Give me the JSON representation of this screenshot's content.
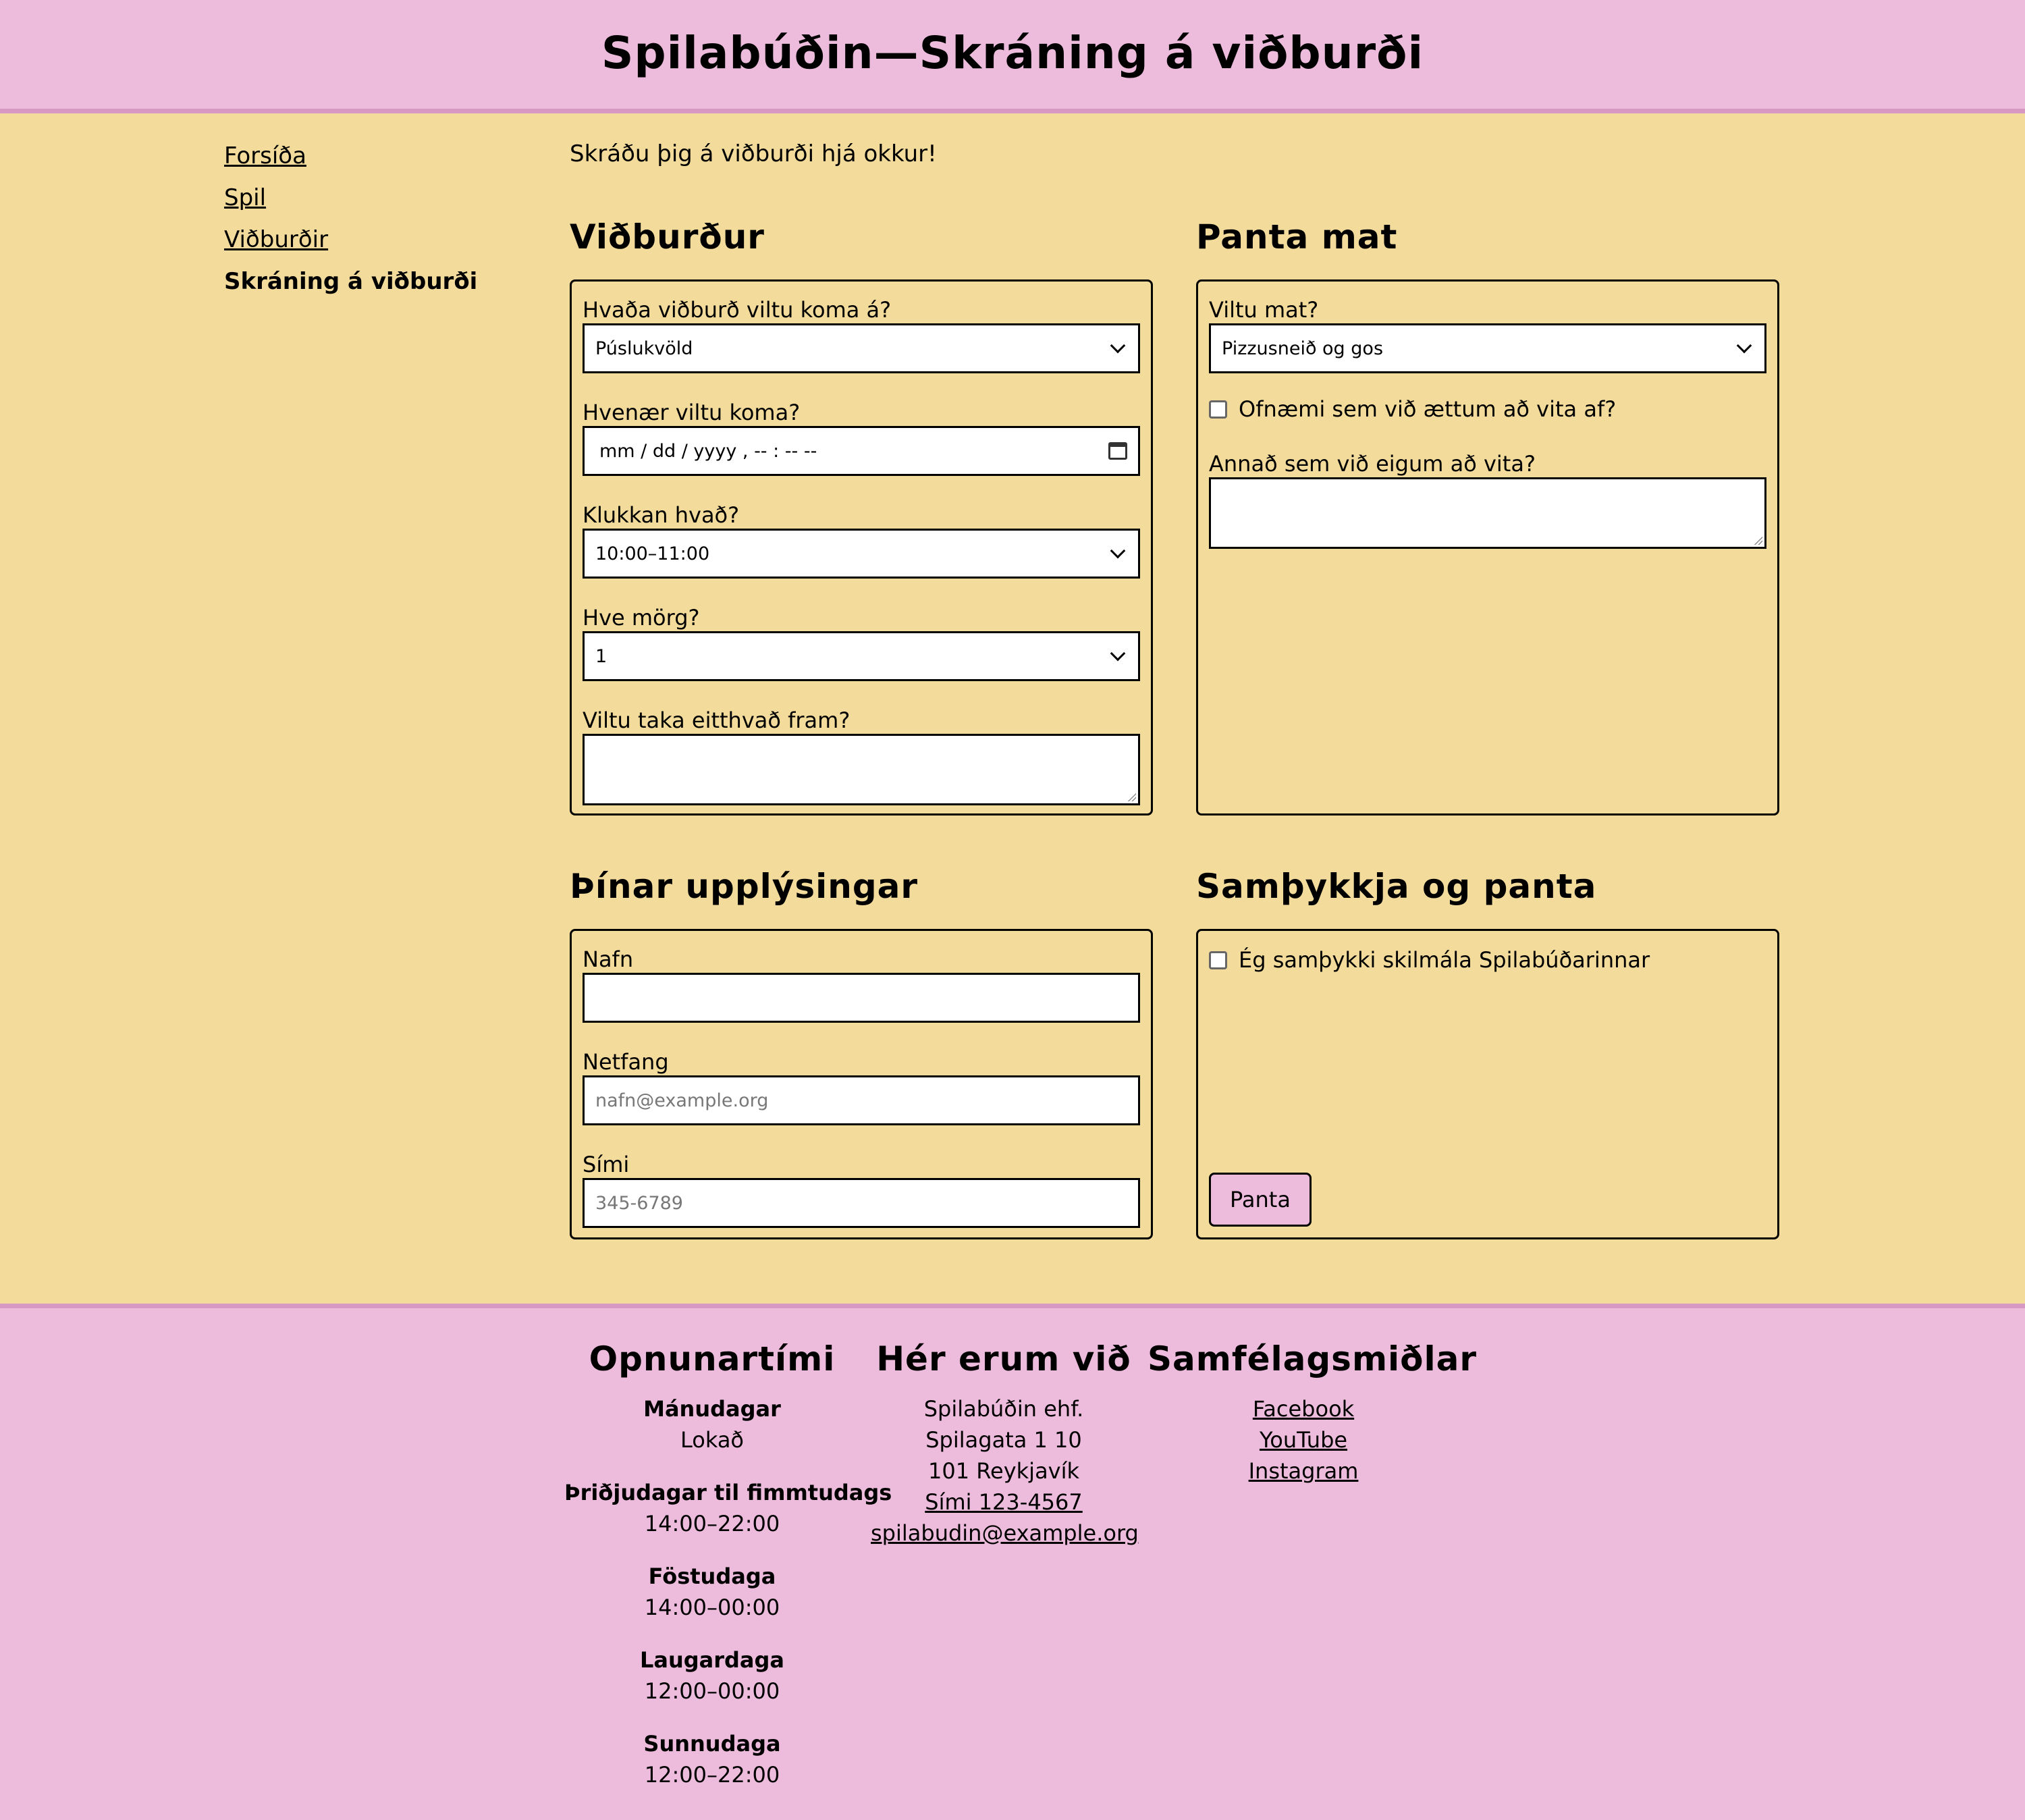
{
  "header": {
    "title": "Spilabúðin—Skráning á viðburði"
  },
  "nav": {
    "items": [
      {
        "label": "Forsíða"
      },
      {
        "label": "Spil"
      },
      {
        "label": "Viðburðir"
      },
      {
        "label": "Skráning á viðburði",
        "current": true
      }
    ]
  },
  "intro": "Skráðu þig á viðburði hjá okkur!",
  "event": {
    "title": "Viðburður",
    "event_label": "Hvaða viðburð viltu koma á?",
    "event_value": "Púslukvöld",
    "when_label": "Hvenær viltu koma?",
    "when_value": "mm / dd / yyyy ,  -- : --   --",
    "time_label": "Klukkan hvað?",
    "time_value": "10:00–11:00",
    "count_label": "Hve mörg?",
    "count_value": "1",
    "extra_label": "Viltu taka eitthvað fram?"
  },
  "food": {
    "title": "Panta mat",
    "food_label": "Viltu mat?",
    "food_value": "Pizzusneið og gos",
    "allergy_label": "Ofnæmi sem við ættum að vita af?",
    "other_label": "Annað sem við eigum að vita?"
  },
  "info": {
    "title": "Þínar upplýsingar",
    "name_label": "Nafn",
    "email_label": "Netfang",
    "email_placeholder": "nafn@example.org",
    "phone_label": "Sími",
    "phone_placeholder": "345-6789"
  },
  "confirm": {
    "title": "Samþykkja og panta",
    "terms_label": "Ég samþykki skilmála Spilabúðarinnar",
    "submit_label": "Panta"
  },
  "footer": {
    "hours": {
      "title": "Opnunartími",
      "rows": [
        {
          "day": "Mánudagar",
          "time": "Lokað"
        },
        {
          "day": "Þriðjudagar til fimmtudags",
          "time": "14:00–22:00"
        },
        {
          "day": "Föstudaga",
          "time": "14:00–00:00"
        },
        {
          "day": "Laugardaga",
          "time": "12:00–00:00"
        },
        {
          "day": "Sunnudaga",
          "time": "12:00–22:00"
        }
      ]
    },
    "location": {
      "title": "Hér erum við",
      "company": "Spilabúðin ehf.",
      "street": "Spilagata 1 10",
      "city": "101 Reykjavík",
      "phone": "Sími 123-4567",
      "email": "spilabudin@example.org"
    },
    "social": {
      "title": "Samfélagsmiðlar",
      "links": [
        "Facebook",
        "YouTube",
        "Instagram"
      ]
    }
  },
  "colors": {
    "header_bg": "#edbcdc",
    "main_bg": "#f3dc9b",
    "border_accent": "#d898c4"
  }
}
